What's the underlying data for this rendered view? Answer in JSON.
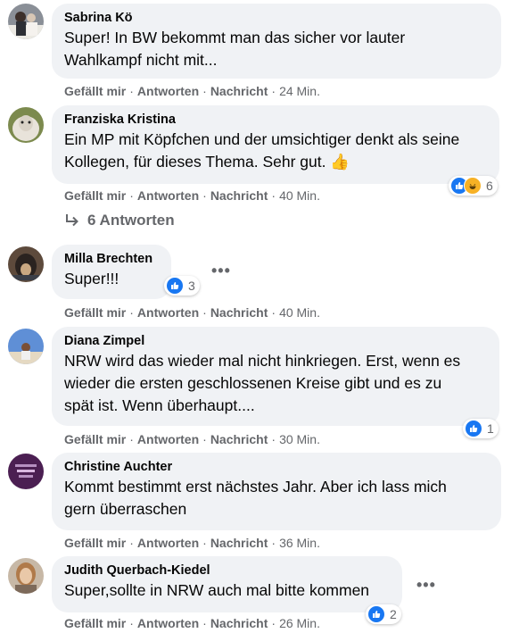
{
  "actions": {
    "like": "Gefällt mir",
    "reply": "Antworten",
    "message": "Nachricht",
    "separator": "·"
  },
  "comments": [
    {
      "author": "Sabrina Kö",
      "lines": [
        "Super! In BW bekommt man das sicher vor lauter",
        "Wahlkampf nicht mit..."
      ],
      "time": "24 Min."
    },
    {
      "author": "Franziska Kristina",
      "lines": [
        "Ein MP mit Köpfchen und der umsichtiger denkt als seine",
        "Kollegen, für dieses Thema. Sehr gut."
      ],
      "emoji": "👍",
      "time": "40 Min.",
      "reactions": "6",
      "reaction_icons": [
        "like-icon",
        "haha-icon"
      ]
    },
    {
      "author": "Milla Brechten",
      "lines": [
        "Super!!!"
      ],
      "time": "40 Min.",
      "reactions": "3",
      "reaction_icons": [
        "like-icon"
      ]
    },
    {
      "author": "Diana Zimpel",
      "lines": [
        "NRW wird das wieder mal nicht hinkriegen. Erst, wenn es",
        "wieder die ersten geschlossenen Kreise gibt und es zu",
        "spät ist. Wenn überhaupt...."
      ],
      "time": "30 Min.",
      "reactions": "1",
      "reaction_icons": [
        "like-icon"
      ]
    },
    {
      "author": "Christine Auchter",
      "lines": [
        "Kommt bestimmt erst nächstes Jahr. Aber ich lass mich",
        "gern überraschen"
      ],
      "time": "36 Min."
    },
    {
      "author": "Judith Querbach-Kiedel",
      "lines": [
        "Super,sollte in NRW auch mal bitte kommen"
      ],
      "time": "26 Min.",
      "reactions": "2",
      "reaction_icons": [
        "like-icon"
      ]
    }
  ],
  "replies_link": "6 Antworten",
  "more_icon": "•••",
  "colors": {
    "bubble": "#f0f2f5",
    "meta": "#65676b",
    "like": "#1877f2",
    "haha": "#f7b125"
  }
}
